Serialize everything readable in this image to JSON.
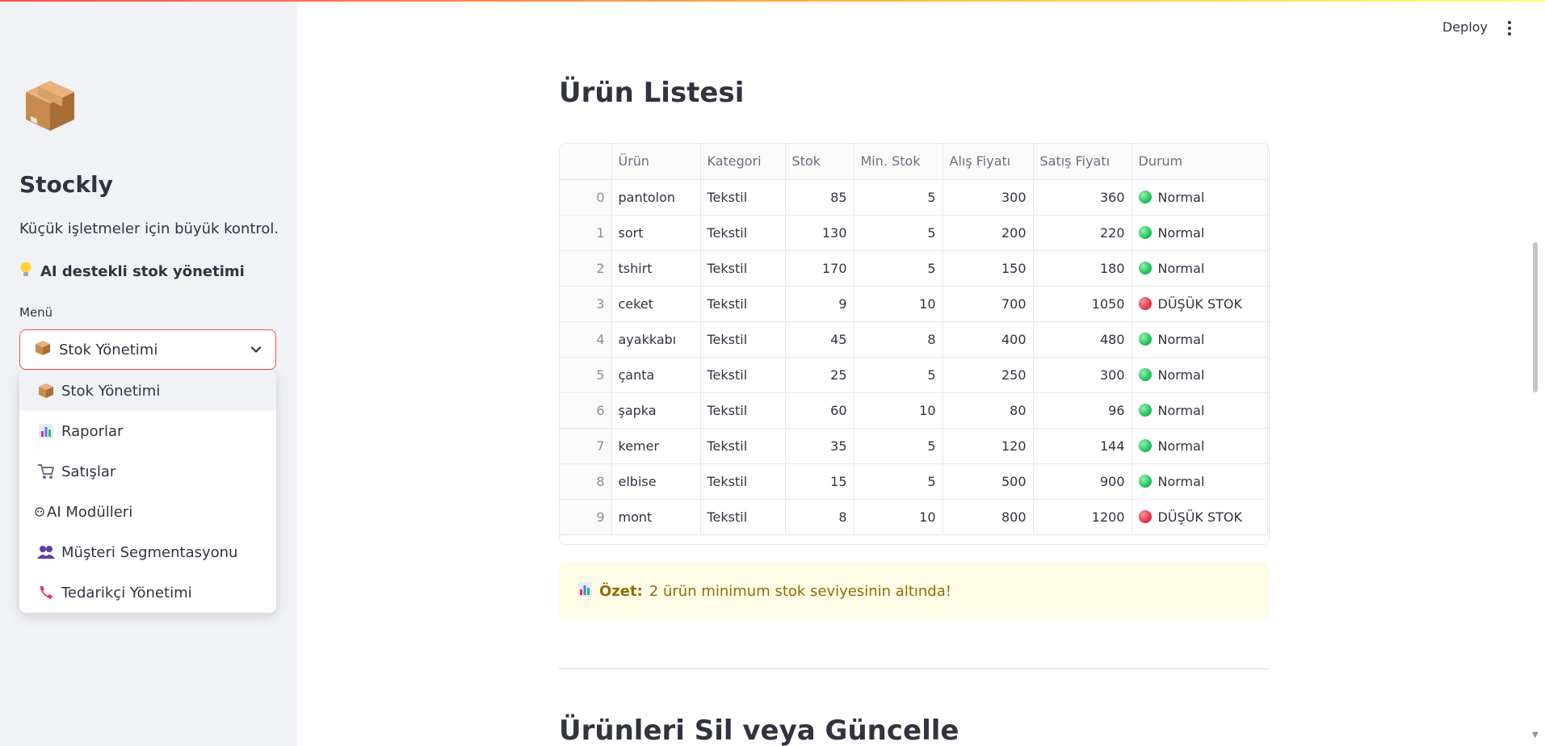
{
  "sidebar": {
    "logo_icon": "package-box-icon",
    "app_title": "Stockly",
    "tagline": "Küçük işletmeler için büyük kontrol.",
    "feature_icon": "lightbulb-icon",
    "feature_text": "AI destekli stok yönetimi",
    "menu_label": "Menü",
    "selected_value": "Stok Yönetimi",
    "options": [
      {
        "icon": "package-icon",
        "label": "Stok Yönetimi"
      },
      {
        "icon": "bar-chart-icon",
        "label": "Raporlar"
      },
      {
        "icon": "shopping-cart-icon",
        "label": "Satışlar"
      },
      {
        "icon": "robot-icon",
        "label": "AI Modülleri"
      },
      {
        "icon": "users-icon",
        "label": "Müşteri Segmentasyonu"
      },
      {
        "icon": "telephone-icon",
        "label": "Tedarikçi Yönetimi"
      }
    ]
  },
  "header": {
    "deploy_label": "Deploy"
  },
  "main": {
    "title": "Ürün Listesi",
    "table": {
      "columns": [
        "",
        "Ürün",
        "Kategori",
        "Stok",
        "Min. Stok",
        "Alış Fiyatı",
        "Satış Fiyatı",
        "Durum"
      ],
      "rows": [
        {
          "idx": "0",
          "urun": "pantolon",
          "kategori": "Tekstil",
          "stok": "85",
          "min": "5",
          "alis": "300",
          "satis": "360",
          "durum": "Normal",
          "status": "green"
        },
        {
          "idx": "1",
          "urun": "sort",
          "kategori": "Tekstil",
          "stok": "130",
          "min": "5",
          "alis": "200",
          "satis": "220",
          "durum": "Normal",
          "status": "green"
        },
        {
          "idx": "2",
          "urun": "tshirt",
          "kategori": "Tekstil",
          "stok": "170",
          "min": "5",
          "alis": "150",
          "satis": "180",
          "durum": "Normal",
          "status": "green"
        },
        {
          "idx": "3",
          "urun": "ceket",
          "kategori": "Tekstil",
          "stok": "9",
          "min": "10",
          "alis": "700",
          "satis": "1050",
          "durum": "DÜŞÜK STOK",
          "status": "red"
        },
        {
          "idx": "4",
          "urun": "ayakkabı",
          "kategori": "Tekstil",
          "stok": "45",
          "min": "8",
          "alis": "400",
          "satis": "480",
          "durum": "Normal",
          "status": "green"
        },
        {
          "idx": "5",
          "urun": "çanta",
          "kategori": "Tekstil",
          "stok": "25",
          "min": "5",
          "alis": "250",
          "satis": "300",
          "durum": "Normal",
          "status": "green"
        },
        {
          "idx": "6",
          "urun": "şapka",
          "kategori": "Tekstil",
          "stok": "60",
          "min": "10",
          "alis": "80",
          "satis": "96",
          "durum": "Normal",
          "status": "green"
        },
        {
          "idx": "7",
          "urun": "kemer",
          "kategori": "Tekstil",
          "stok": "35",
          "min": "5",
          "alis": "120",
          "satis": "144",
          "durum": "Normal",
          "status": "green"
        },
        {
          "idx": "8",
          "urun": "elbise",
          "kategori": "Tekstil",
          "stok": "15",
          "min": "5",
          "alis": "500",
          "satis": "900",
          "durum": "Normal",
          "status": "green"
        },
        {
          "idx": "9",
          "urun": "mont",
          "kategori": "Tekstil",
          "stok": "8",
          "min": "10",
          "alis": "800",
          "satis": "1200",
          "durum": "DÜŞÜK STOK",
          "status": "red"
        }
      ]
    },
    "summary": {
      "icon": "bar-chart-icon",
      "label": "Özet:",
      "text": "2 ürün minimum stok seviyesinin altında!"
    },
    "section_title": "Ürünleri Sil veya Güncelle"
  },
  "colors": {
    "accent": "#ff4b4b",
    "sidebar_bg": "#f0f2f6",
    "summary_bg": "#fffce7",
    "summary_text": "#926c05",
    "status_green": "#21c45d",
    "status_red": "#e8334a"
  }
}
